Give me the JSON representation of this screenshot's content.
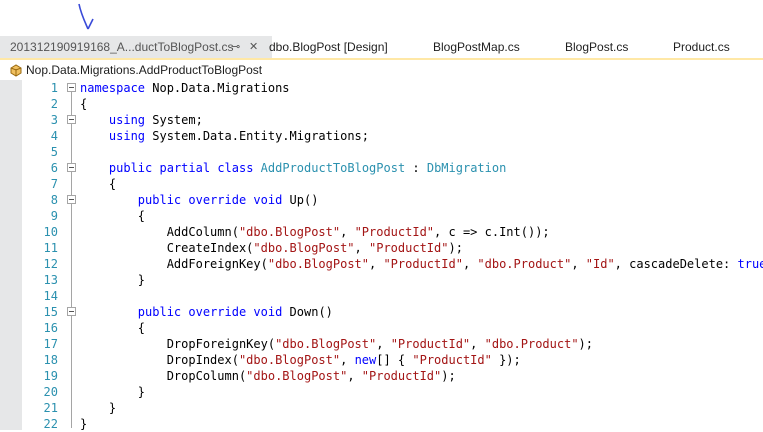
{
  "tabs": [
    {
      "label": "201312190919168_A...ductToBlogPost.cs",
      "active": true,
      "pin": "⊸",
      "close": "✕"
    },
    {
      "label": "dbo.BlogPost [Design]"
    },
    {
      "label": "BlogPostMap.cs"
    },
    {
      "label": "BlogPost.cs"
    },
    {
      "label": "Product.cs"
    }
  ],
  "navbar": {
    "icon": "class-icon",
    "label": "Nop.Data.Migrations.AddProductToBlogPost"
  },
  "lines": [
    {
      "n": "1",
      "fold": true,
      "seg": [
        {
          "k": "kw",
          "t": "namespace"
        },
        {
          "t": " Nop.Data.Migrations"
        }
      ]
    },
    {
      "n": "2",
      "seg": [
        {
          "t": "{"
        }
      ]
    },
    {
      "n": "3",
      "fold": true,
      "seg": [
        {
          "t": "    "
        },
        {
          "k": "kw",
          "t": "using"
        },
        {
          "t": " System;"
        }
      ]
    },
    {
      "n": "4",
      "seg": [
        {
          "t": "    "
        },
        {
          "k": "kw",
          "t": "using"
        },
        {
          "t": " System.Data.Entity.Migrations;"
        }
      ]
    },
    {
      "n": "5",
      "seg": [
        {
          "t": ""
        }
      ]
    },
    {
      "n": "6",
      "fold": true,
      "seg": [
        {
          "t": "    "
        },
        {
          "k": "kw",
          "t": "public"
        },
        {
          "t": " "
        },
        {
          "k": "kw",
          "t": "partial"
        },
        {
          "t": " "
        },
        {
          "k": "kw",
          "t": "class"
        },
        {
          "t": " "
        },
        {
          "k": "typ",
          "t": "AddProductToBlogPost"
        },
        {
          "t": " : "
        },
        {
          "k": "typ",
          "t": "DbMigration"
        }
      ]
    },
    {
      "n": "7",
      "seg": [
        {
          "t": "    {"
        }
      ]
    },
    {
      "n": "8",
      "fold": true,
      "seg": [
        {
          "t": "        "
        },
        {
          "k": "kw",
          "t": "public"
        },
        {
          "t": " "
        },
        {
          "k": "kw",
          "t": "override"
        },
        {
          "t": " "
        },
        {
          "k": "kw",
          "t": "void"
        },
        {
          "t": " Up()"
        }
      ]
    },
    {
      "n": "9",
      "seg": [
        {
          "t": "        {"
        }
      ]
    },
    {
      "n": "10",
      "seg": [
        {
          "t": "            AddColumn("
        },
        {
          "k": "str",
          "t": "\"dbo.BlogPost\""
        },
        {
          "t": ", "
        },
        {
          "k": "str",
          "t": "\"ProductId\""
        },
        {
          "t": ", c => c.Int());"
        }
      ]
    },
    {
      "n": "11",
      "seg": [
        {
          "t": "            CreateIndex("
        },
        {
          "k": "str",
          "t": "\"dbo.BlogPost\""
        },
        {
          "t": ", "
        },
        {
          "k": "str",
          "t": "\"ProductId\""
        },
        {
          "t": ");"
        }
      ]
    },
    {
      "n": "12",
      "seg": [
        {
          "t": "            AddForeignKey("
        },
        {
          "k": "str",
          "t": "\"dbo.BlogPost\""
        },
        {
          "t": ", "
        },
        {
          "k": "str",
          "t": "\"ProductId\""
        },
        {
          "t": ", "
        },
        {
          "k": "str",
          "t": "\"dbo.Product\""
        },
        {
          "t": ", "
        },
        {
          "k": "str",
          "t": "\"Id\""
        },
        {
          "t": ", cascadeDelete: "
        },
        {
          "k": "kw",
          "t": "true"
        },
        {
          "t": ");"
        }
      ]
    },
    {
      "n": "13",
      "seg": [
        {
          "t": "        }"
        }
      ]
    },
    {
      "n": "14",
      "seg": [
        {
          "t": ""
        }
      ]
    },
    {
      "n": "15",
      "fold": true,
      "seg": [
        {
          "t": "        "
        },
        {
          "k": "kw",
          "t": "public"
        },
        {
          "t": " "
        },
        {
          "k": "kw",
          "t": "override"
        },
        {
          "t": " "
        },
        {
          "k": "kw",
          "t": "void"
        },
        {
          "t": " Down()"
        }
      ]
    },
    {
      "n": "16",
      "seg": [
        {
          "t": "        {"
        }
      ]
    },
    {
      "n": "17",
      "seg": [
        {
          "t": "            DropForeignKey("
        },
        {
          "k": "str",
          "t": "\"dbo.BlogPost\""
        },
        {
          "t": ", "
        },
        {
          "k": "str",
          "t": "\"ProductId\""
        },
        {
          "t": ", "
        },
        {
          "k": "str",
          "t": "\"dbo.Product\""
        },
        {
          "t": ");"
        }
      ]
    },
    {
      "n": "18",
      "seg": [
        {
          "t": "            DropIndex("
        },
        {
          "k": "str",
          "t": "\"dbo.BlogPost\""
        },
        {
          "t": ", "
        },
        {
          "k": "kw",
          "t": "new"
        },
        {
          "t": "[] { "
        },
        {
          "k": "str",
          "t": "\"ProductId\""
        },
        {
          "t": " });"
        }
      ]
    },
    {
      "n": "19",
      "seg": [
        {
          "t": "            DropColumn("
        },
        {
          "k": "str",
          "t": "\"dbo.BlogPost\""
        },
        {
          "t": ", "
        },
        {
          "k": "str",
          "t": "\"ProductId\""
        },
        {
          "t": ");"
        }
      ]
    },
    {
      "n": "20",
      "seg": [
        {
          "t": "        }"
        }
      ]
    },
    {
      "n": "21",
      "seg": [
        {
          "t": "    }"
        }
      ]
    },
    {
      "n": "22",
      "seg": [
        {
          "t": "}"
        }
      ]
    }
  ]
}
